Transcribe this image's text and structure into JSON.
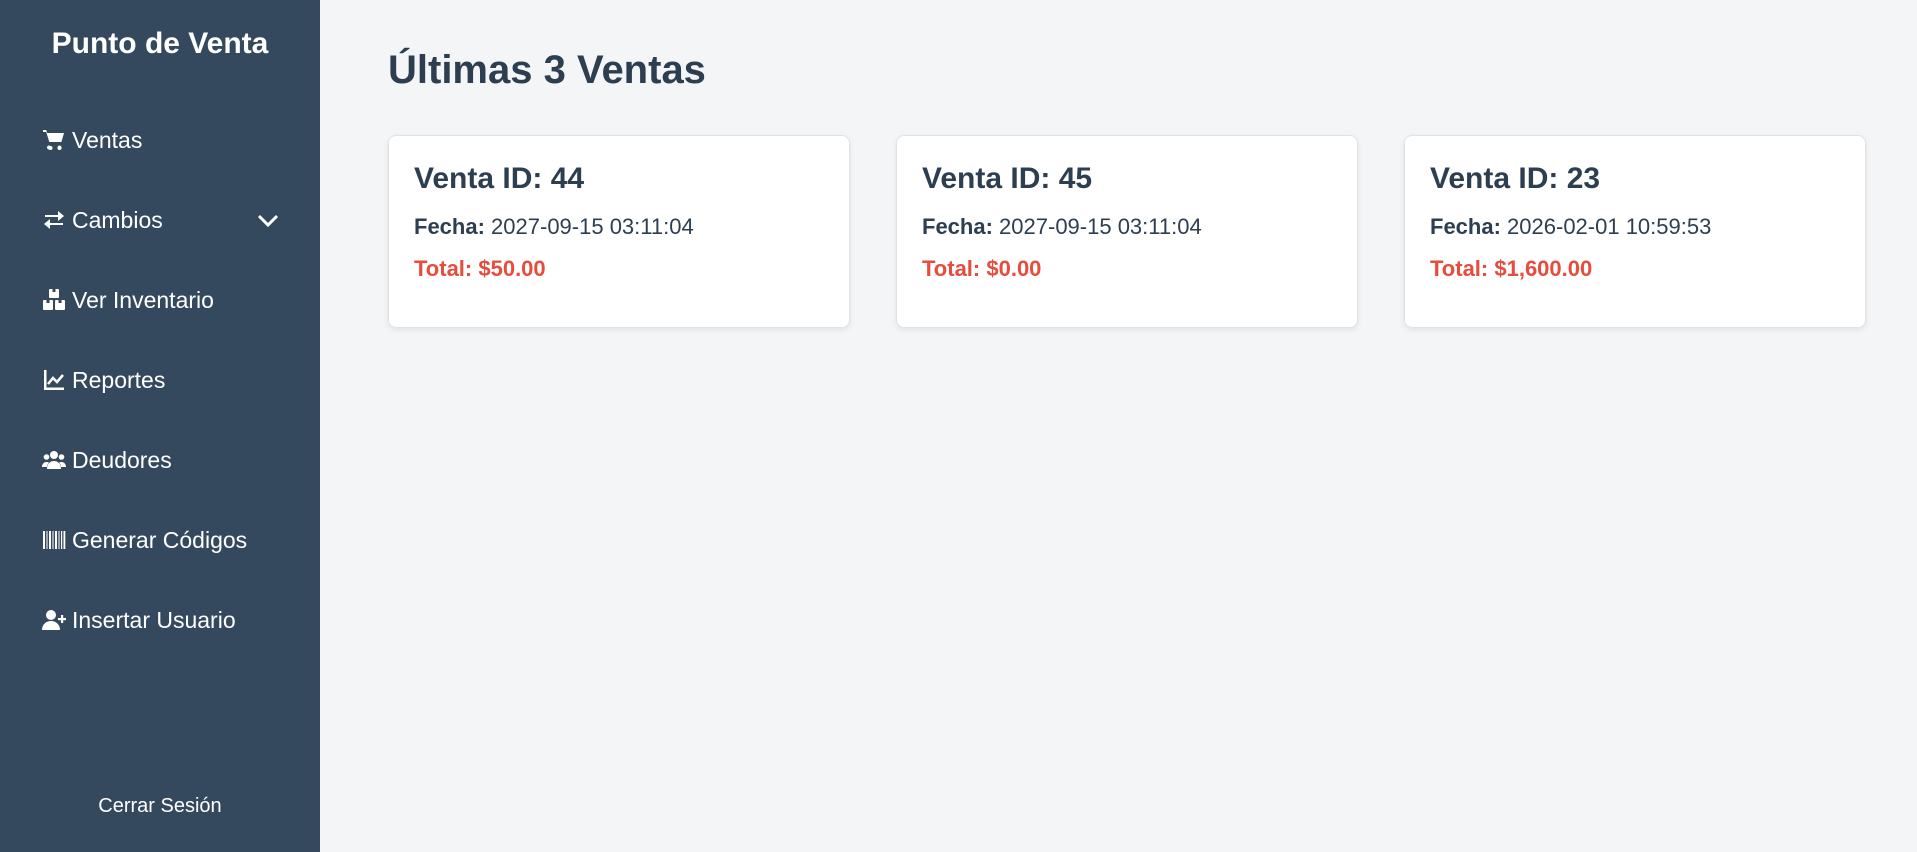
{
  "sidebar": {
    "brand": "Punto de Venta",
    "items": [
      {
        "label": "Ventas",
        "icon": "shopping-cart-icon"
      },
      {
        "label": "Cambios",
        "icon": "exchange-arrows-icon",
        "has_dropdown": true
      },
      {
        "label": "Ver Inventario",
        "icon": "boxes-icon"
      },
      {
        "label": "Reportes",
        "icon": "line-chart-icon"
      },
      {
        "label": "Deudores",
        "icon": "users-icon"
      },
      {
        "label": "Generar Códigos",
        "icon": "barcode-icon"
      },
      {
        "label": "Insertar Usuario",
        "icon": "user-plus-icon"
      }
    ],
    "logout": "Cerrar Sesión"
  },
  "main": {
    "title": "Últimas 3 Ventas",
    "date_label": "Fecha:",
    "sales": [
      {
        "title": "Venta ID: 44",
        "date": "2027-09-15 03:11:04",
        "total": "Total: $50.00"
      },
      {
        "title": "Venta ID: 45",
        "date": "2027-09-15 03:11:04",
        "total": "Total: $0.00"
      },
      {
        "title": "Venta ID: 23",
        "date": "2026-02-01 10:59:53",
        "total": "Total: $1,600.00"
      }
    ]
  },
  "colors": {
    "sidebar_bg": "#34495e",
    "page_bg": "#f4f5f7",
    "heading": "#2c3e50",
    "total": "#e74c3c"
  }
}
